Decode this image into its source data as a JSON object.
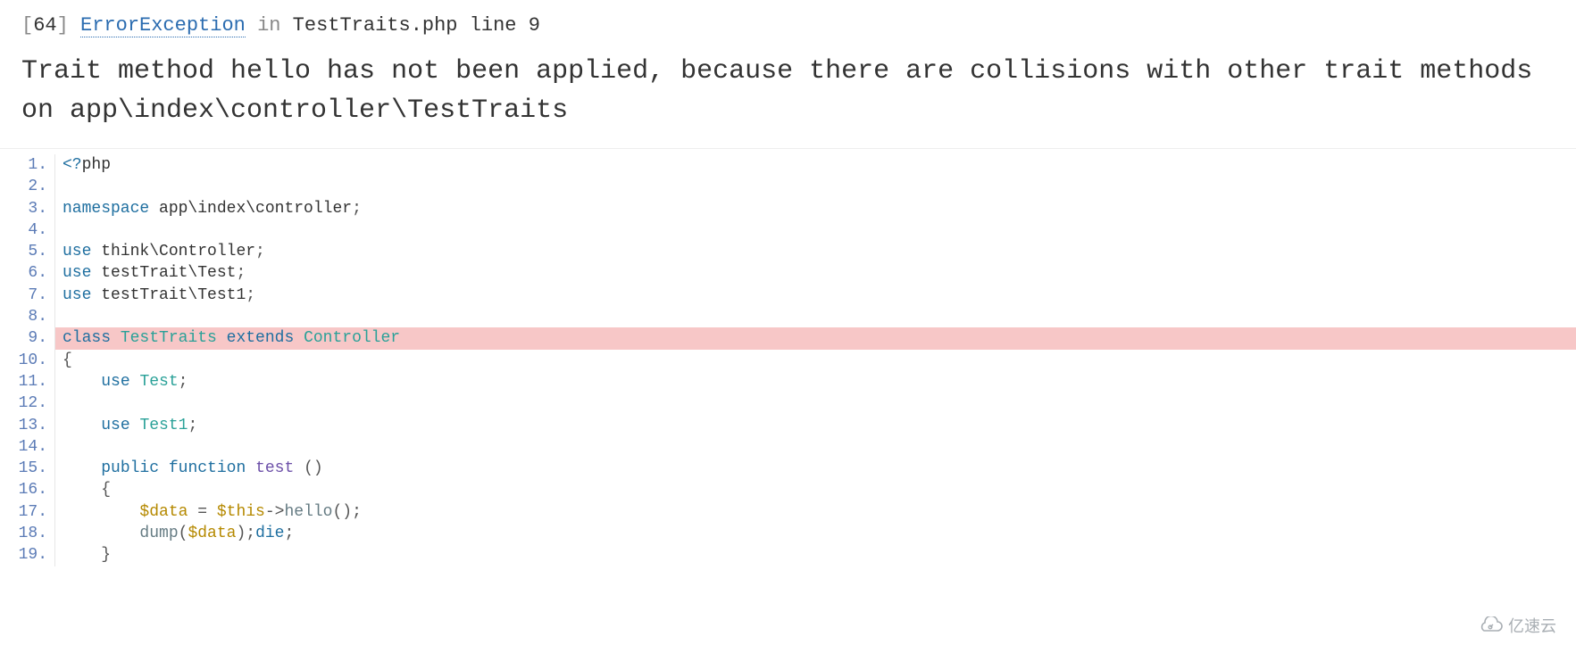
{
  "header": {
    "code_bracket_open": "[",
    "code": "64",
    "code_bracket_close": "]",
    "exception_name": "ErrorException",
    "in_word": "in",
    "file_location": "TestTraits.php line 9"
  },
  "error_message": "Trait method hello has not been applied, because there are collisions with other trait methods on app\\index\\controller\\TestTraits",
  "code": {
    "highlighted_line": 9,
    "lines": [
      {
        "n": 1,
        "tokens": [
          {
            "t": "<?",
            "c": "tk-keyword"
          },
          {
            "t": "php",
            "c": ""
          }
        ]
      },
      {
        "n": 2,
        "tokens": []
      },
      {
        "n": 3,
        "tokens": [
          {
            "t": "namespace ",
            "c": "tk-keyword"
          },
          {
            "t": "app\\index\\controller",
            "c": ""
          },
          {
            "t": ";",
            "c": "tk-punc"
          }
        ]
      },
      {
        "n": 4,
        "tokens": []
      },
      {
        "n": 5,
        "tokens": [
          {
            "t": "use ",
            "c": "tk-keyword"
          },
          {
            "t": "think\\Controller",
            "c": ""
          },
          {
            "t": ";",
            "c": "tk-punc"
          }
        ]
      },
      {
        "n": 6,
        "tokens": [
          {
            "t": "use ",
            "c": "tk-keyword"
          },
          {
            "t": "testTrait\\Test",
            "c": ""
          },
          {
            "t": ";",
            "c": "tk-punc"
          }
        ]
      },
      {
        "n": 7,
        "tokens": [
          {
            "t": "use ",
            "c": "tk-keyword"
          },
          {
            "t": "testTrait\\Test1",
            "c": ""
          },
          {
            "t": ";",
            "c": "tk-punc"
          }
        ]
      },
      {
        "n": 8,
        "tokens": []
      },
      {
        "n": 9,
        "tokens": [
          {
            "t": "class ",
            "c": "tk-keyword"
          },
          {
            "t": "TestTraits ",
            "c": "tk-ns"
          },
          {
            "t": "extends ",
            "c": "tk-keyword"
          },
          {
            "t": "Controller",
            "c": "tk-ns"
          }
        ]
      },
      {
        "n": 10,
        "tokens": [
          {
            "t": "{",
            "c": "tk-punc"
          }
        ]
      },
      {
        "n": 11,
        "tokens": [
          {
            "t": "    ",
            "c": ""
          },
          {
            "t": "use ",
            "c": "tk-keyword"
          },
          {
            "t": "Test",
            "c": "tk-ns"
          },
          {
            "t": ";",
            "c": "tk-punc"
          }
        ]
      },
      {
        "n": 12,
        "tokens": []
      },
      {
        "n": 13,
        "tokens": [
          {
            "t": "    ",
            "c": ""
          },
          {
            "t": "use ",
            "c": "tk-keyword"
          },
          {
            "t": "Test1",
            "c": "tk-ns"
          },
          {
            "t": ";",
            "c": "tk-punc"
          }
        ]
      },
      {
        "n": 14,
        "tokens": []
      },
      {
        "n": 15,
        "tokens": [
          {
            "t": "    ",
            "c": ""
          },
          {
            "t": "public ",
            "c": "tk-keyword"
          },
          {
            "t": "function ",
            "c": "tk-keyword"
          },
          {
            "t": "test ",
            "c": "tk-purple"
          },
          {
            "t": "()",
            "c": "tk-punc"
          }
        ]
      },
      {
        "n": 16,
        "tokens": [
          {
            "t": "    {",
            "c": "tk-punc"
          }
        ]
      },
      {
        "n": 17,
        "tokens": [
          {
            "t": "        ",
            "c": ""
          },
          {
            "t": "$data",
            "c": "tk-var"
          },
          {
            "t": " = ",
            "c": "tk-punc"
          },
          {
            "t": "$this",
            "c": "tk-var"
          },
          {
            "t": "->",
            "c": "tk-punc"
          },
          {
            "t": "hello",
            "c": "tk-func"
          },
          {
            "t": "();",
            "c": "tk-punc"
          }
        ]
      },
      {
        "n": 18,
        "tokens": [
          {
            "t": "        ",
            "c": ""
          },
          {
            "t": "dump",
            "c": "tk-func"
          },
          {
            "t": "(",
            "c": "tk-punc"
          },
          {
            "t": "$data",
            "c": "tk-var"
          },
          {
            "t": ");",
            "c": "tk-punc"
          },
          {
            "t": "die",
            "c": "tk-keyword"
          },
          {
            "t": ";",
            "c": "tk-punc"
          }
        ]
      },
      {
        "n": 19,
        "tokens": [
          {
            "t": "    }",
            "c": "tk-punc"
          }
        ]
      }
    ]
  },
  "watermark": {
    "text": "亿速云"
  }
}
